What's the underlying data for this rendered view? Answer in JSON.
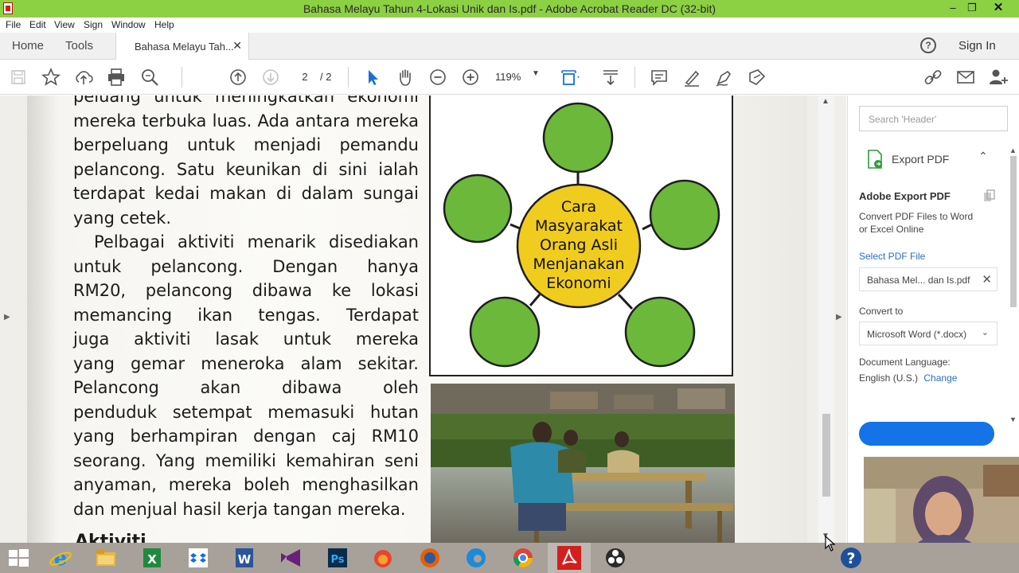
{
  "window": {
    "title": "Bahasa Melayu Tahun 4-Lokasi Unik dan Is.pdf - Adobe Acrobat Reader DC (32-bit)"
  },
  "menu": [
    "File",
    "Edit",
    "View",
    "Sign",
    "Window",
    "Help"
  ],
  "tabs": {
    "home": "Home",
    "tools": "Tools",
    "document": "Bahasa Melayu Tah...",
    "sign_in": "Sign In"
  },
  "toolbar": {
    "page_current": "2",
    "page_total": "/ 2",
    "zoom": "119%"
  },
  "document": {
    "para1_lines": [
      "peluang untuk meningkatkan ekonomi",
      "mereka terbuka luas. Ada antara mereka",
      "berpeluang untuk menjadi pemandu",
      "pelancong. Satu keunikan di sini ialah",
      "terdapat kedai makan di dalam sungai",
      "yang cetek."
    ],
    "para2_lines": [
      "Pelbagai aktiviti menarik disediakan",
      "untuk pelancong. Dengan hanya",
      "RM20, pelancong dibawa ke lokasi",
      "memancing ikan tengas. Terdapat",
      "juga aktiviti lasak untuk mereka",
      "yang gemar meneroka alam sekitar.",
      "Pelancong akan dibawa oleh",
      "penduduk setempat memasuki hutan",
      "yang berhampiran dengan caj RM10",
      "seorang. Yang memiliki kemahiran seni",
      "anyaman, mereka boleh menghasilkan",
      "dan menjual hasil kerja tangan mereka."
    ],
    "next_heading": "Aktiviti",
    "diagram_center": [
      "Cara",
      "Masyarakat",
      "Orang Asli",
      "Menjanakan",
      "Ekonomi"
    ]
  },
  "right_pane": {
    "search_placeholder": "Search 'Header'",
    "export_label": "Export PDF",
    "export_title": "Adobe Export PDF",
    "export_desc": "Convert PDF Files to Word or Excel Online",
    "select_file": "Select PDF File",
    "file_name": "Bahasa Mel... dan Is.pdf",
    "convert_to": "Convert to",
    "format": "Microsoft Word (*.docx)",
    "doc_language": "Document Language:",
    "language": "English (U.S.)",
    "change": "Change"
  },
  "taskbar_apps": [
    "start",
    "internet-explorer",
    "file-explorer",
    "excel",
    "dropbox",
    "word",
    "visual-studio",
    "photoshop",
    "firefox-dev",
    "firefox",
    "edge",
    "chrome",
    "acrobat",
    "obs",
    "help"
  ],
  "colors": {
    "titlebar": "#8cd044",
    "diagram_circle": "#6cb83a",
    "diagram_center": "#f0cc1e",
    "accent_blue": "#1473e6"
  }
}
